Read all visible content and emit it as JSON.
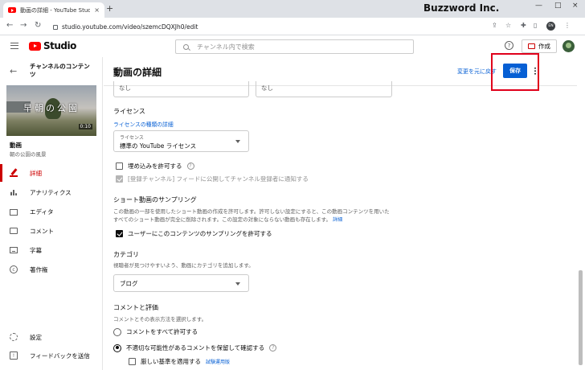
{
  "browser": {
    "tab_title": "動画の詳細 - YouTube Studio",
    "tab_close": "×",
    "new_tab": "+",
    "brand": "Buzzword Inc.",
    "url": "studio.youtube.com/video/szemcDQXJh0/edit",
    "profile_initials": "EN",
    "window_controls": [
      "—",
      "□",
      "×"
    ]
  },
  "header": {
    "logo_text": "Studio",
    "search_placeholder": "チャンネル内で検索",
    "help": "?",
    "create_label": "作成"
  },
  "sidebar": {
    "back": "←",
    "channel_title": "チャンネルのコンテンツ",
    "thumbnail_text": "早朝の公園",
    "duration": "0:10",
    "video_label": "動画",
    "video_title": "朝の公園の風景",
    "items": [
      {
        "label": "詳細",
        "icon": "pencil-icon",
        "active": true
      },
      {
        "label": "アナリティクス",
        "icon": "analytics-icon"
      },
      {
        "label": "エディタ",
        "icon": "editor-icon"
      },
      {
        "label": "コメント",
        "icon": "comment-icon"
      },
      {
        "label": "字幕",
        "icon": "subtitles-icon"
      },
      {
        "label": "著作権",
        "icon": "copyright-icon"
      }
    ],
    "settings_label": "設定",
    "feedback_label": "フィードバックを送信"
  },
  "main": {
    "title": "動画の詳細",
    "undo_label": "変更を元に戻す",
    "save_label": "保存",
    "top_field_left": "なし",
    "top_field_right": "なし",
    "license": {
      "title": "ライセンス",
      "link": "ライセンスの種類の詳細",
      "select_label": "ライセンス",
      "select_value": "標準の YouTube ライセンス",
      "embed_label": "埋め込みを許可する",
      "notify_label": "[登録チャンネル] フィードに公開してチャンネル登録者に通知する"
    },
    "shorts": {
      "title": "ショート動画のサンプリング",
      "desc_line1": "この動画の一部を使用したショート動画の作成を許可します。許可しない設定にすると、この動画コンテンツを用いた",
      "desc_line2": "すべてのショート動画が完全に削除されます。この設定の対象にならない動画も存在します。",
      "desc_link": "詳細",
      "checkbox_label": "ユーザーにこのコンテンツのサンプリングを許可する"
    },
    "category": {
      "title": "カテゴリ",
      "desc": "視聴者が見つけやすいよう、動画にカテゴリを追加します。",
      "value": "ブログ"
    },
    "comments": {
      "title": "コメントと評価",
      "desc": "コメントとその表示方法を選択します。",
      "opt_all": "コメントをすべて許可する",
      "opt_hold": "不適切な可能性があるコメントを保留して確認する",
      "strict_label": "厳しい基準を適用する",
      "beta": "試験運用版"
    }
  },
  "colors": {
    "accent_blue": "#065fd4",
    "active_red": "#cc0000",
    "highlight_frame": "#e0001b"
  }
}
